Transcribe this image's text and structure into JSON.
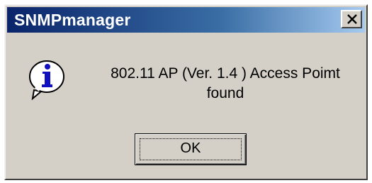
{
  "window": {
    "title": "SNMPmanager",
    "close_icon": "close-icon"
  },
  "dialog": {
    "icon": "info-icon",
    "message_line1": "802.11 AP (Ver. 1.4 ) Access Poimt",
    "message_line2": "found",
    "ok_label": "OK"
  }
}
